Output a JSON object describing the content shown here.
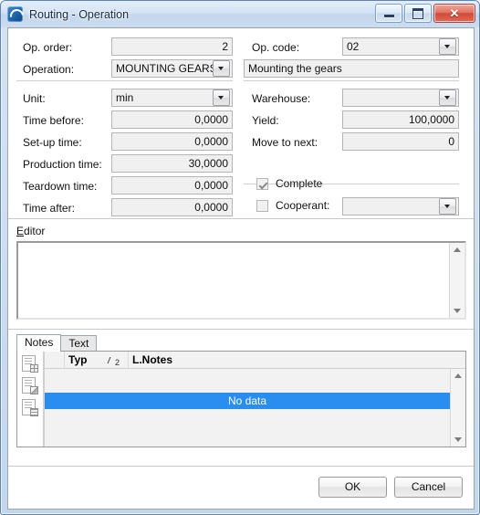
{
  "window": {
    "title": "Routing - Operation",
    "app_icon": "routing-app-icon",
    "controls": {
      "minimize": "minimize-icon",
      "maximize": "maximize-icon",
      "close": "✕"
    }
  },
  "form": {
    "left": {
      "op_order": {
        "label": "Op. order:",
        "value": "2"
      },
      "operation": {
        "label": "Operation:",
        "value": "MOUNTING GEARS"
      },
      "unit": {
        "label": "Unit:",
        "value": "min"
      },
      "time_before": {
        "label": "Time before:",
        "value": "0,0000"
      },
      "setup_time": {
        "label": "Set-up time:",
        "value": "0,0000"
      },
      "production_time": {
        "label": "Production time:",
        "value": "30,0000"
      },
      "teardown_time": {
        "label": "Teardown time:",
        "value": "0,0000"
      },
      "time_after": {
        "label": "Time after:",
        "value": "0,0000"
      }
    },
    "right": {
      "op_code": {
        "label": "Op. code:",
        "value": "02"
      },
      "description": {
        "value": "Mounting the gears"
      },
      "warehouse": {
        "label": "Warehouse:",
        "value": ""
      },
      "yield": {
        "label": "Yield:",
        "value": "100,0000"
      },
      "move_to_next": {
        "label": "Move to next:",
        "value": "0"
      },
      "complete": {
        "label": "Complete",
        "checked": true
      },
      "cooperant": {
        "label": "Cooperant:",
        "checked": false,
        "value": ""
      }
    }
  },
  "editor": {
    "label_accel": "E",
    "label_rest": "ditor",
    "value": ""
  },
  "tabs": {
    "items": [
      {
        "label": "Notes",
        "active": true
      },
      {
        "label": "Text",
        "active": false
      }
    ]
  },
  "grid": {
    "tools": [
      {
        "icon": "document-grid-icon"
      },
      {
        "icon": "document-image-icon"
      },
      {
        "icon": "document-form-icon"
      }
    ],
    "columns": [
      {
        "label": ""
      },
      {
        "label": "Typ"
      },
      {
        "label": "",
        "sort": "asc",
        "sort_order": "2"
      },
      {
        "label": "L.Notes"
      }
    ],
    "empty_message": "No data",
    "empty_row_color": "#2a8ef0"
  },
  "buttons": {
    "ok": "OK",
    "cancel": "Cancel"
  }
}
